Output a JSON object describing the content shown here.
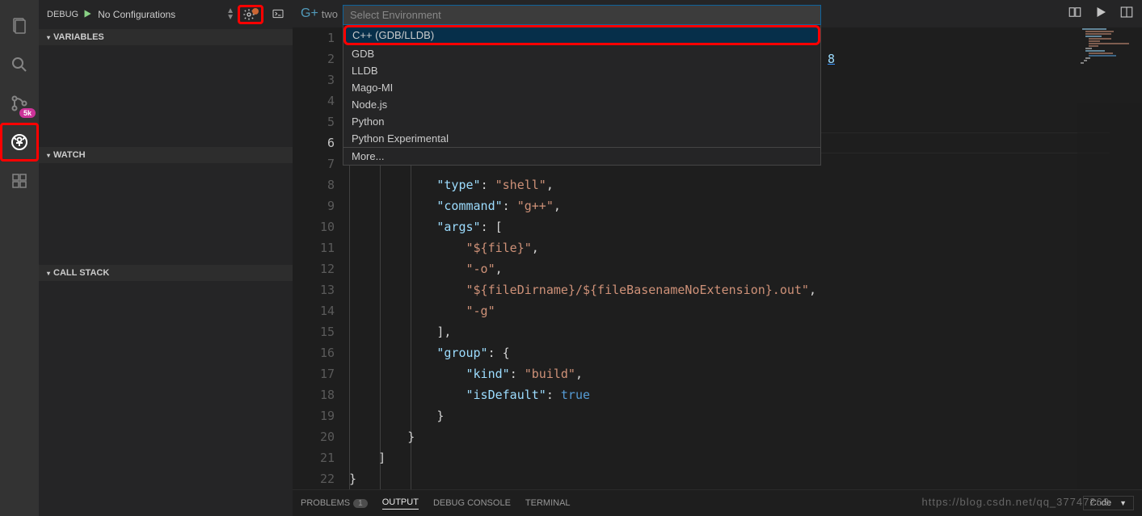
{
  "activitybar": {
    "scm_badge": "5k"
  },
  "debug_toolbar": {
    "label": "DEBUG",
    "config": "No Configurations"
  },
  "sections": {
    "variables": "VARIABLES",
    "watch": "WATCH",
    "callstack": "CALL STACK"
  },
  "tab": {
    "label": "two"
  },
  "quickpick": {
    "placeholder": "Select Environment",
    "items": [
      "C++ (GDB/LLDB)",
      "GDB",
      "LLDB",
      "Mago-MI",
      "Node.js",
      "Python",
      "Python Experimental"
    ],
    "more": "More..."
  },
  "code": {
    "line2_link": "8",
    "line8": "            \"type\": \"shell\",",
    "line9": "            \"command\": \"g++\",",
    "line10": "            \"args\": [",
    "line11": "                \"${file}\",",
    "line12": "                \"-o\",",
    "line13": "                \"${fileDirname}/${fileBasenameNoExtension}.out\",",
    "line14": "                \"-g\"",
    "line15": "            ],",
    "line16": "            \"group\": {",
    "line17": "                \"kind\": \"build\",",
    "line18": "                \"isDefault\": true",
    "line19": "            }",
    "line20": "        }",
    "line21": "    ]",
    "line22": "}"
  },
  "panel": {
    "problems": "PROBLEMS",
    "problems_count": "1",
    "output": "OUTPUT",
    "debug_console": "DEBUG CONSOLE",
    "terminal": "TERMINAL",
    "right_label": "Code"
  },
  "watermark": "https://blog.csdn.net/qq_37747262"
}
